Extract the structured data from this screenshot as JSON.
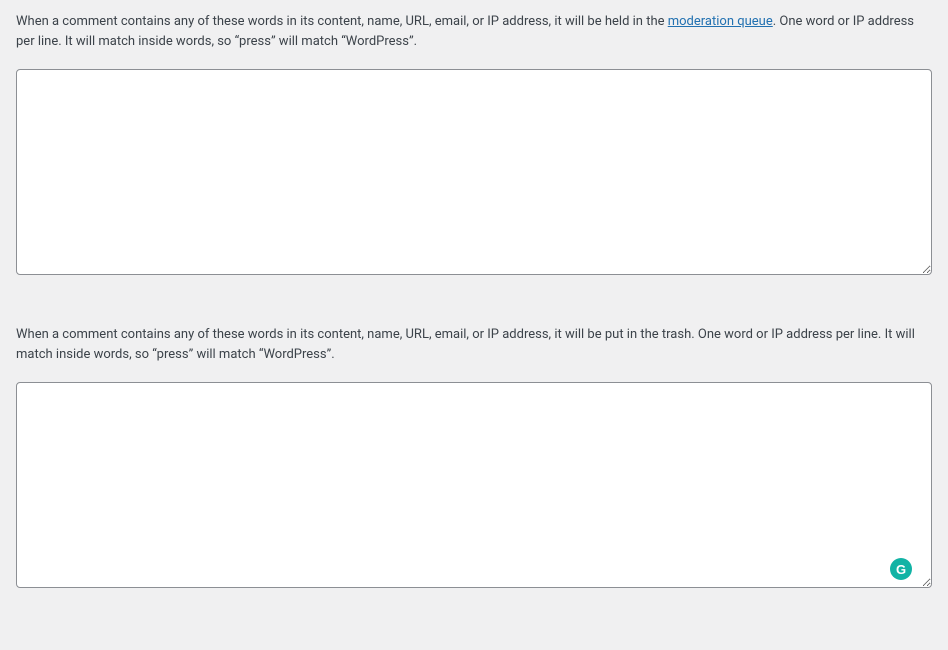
{
  "moderation": {
    "desc_before": "When a comment contains any of these words in its content, name, URL, email, or IP address, it will be held in the ",
    "link_text": "moderation queue",
    "desc_after": ". One word or IP address per line. It will match inside words, so “press” will match “WordPress”.",
    "textarea_value": ""
  },
  "disallowed": {
    "desc": "When a comment contains any of these words in its content, name, URL, email, or IP address, it will be put in the trash. One word or IP address per line. It will match inside words, so “press” will match “WordPress”.",
    "textarea_value": ""
  },
  "grammarly_badge": "G"
}
